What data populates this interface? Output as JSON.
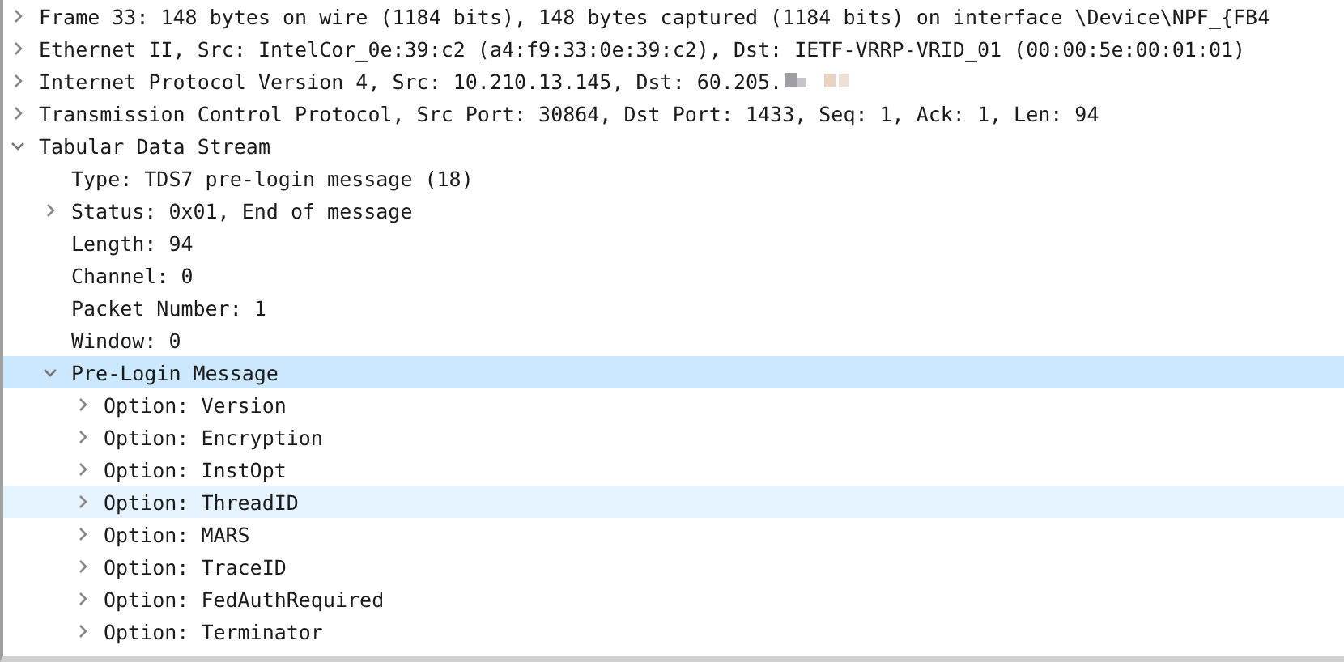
{
  "tree": [
    {
      "label": "Frame 33: 148 bytes on wire (1184 bits), 148 bytes captured (1184 bits) on interface \\Device\\NPF_{FB4",
      "expanded": false,
      "selected": false,
      "hovered": false
    },
    {
      "label": "Ethernet II, Src: IntelCor_0e:39:c2 (a4:f9:33:0e:39:c2), Dst: IETF-VRRP-VRID_01 (00:00:5e:00:01:01)",
      "expanded": false,
      "selected": false,
      "hovered": false
    },
    {
      "label": "Internet Protocol Version 4, Src: 10.210.13.145, Dst: 60.205.",
      "redacted": true,
      "expanded": false,
      "selected": false,
      "hovered": false
    },
    {
      "label": "Transmission Control Protocol, Src Port: 30864, Dst Port: 1433, Seq: 1, Ack: 1, Len: 94",
      "expanded": false,
      "selected": false,
      "hovered": false
    },
    {
      "label": "Tabular Data Stream",
      "expanded": true,
      "selected": false,
      "hovered": false,
      "children": [
        {
          "label": "Type: TDS7 pre-login message (18)",
          "selected": false,
          "hovered": false
        },
        {
          "label": "Status: 0x01, End of message",
          "expanded": false,
          "selected": false,
          "hovered": false
        },
        {
          "label": "Length: 94",
          "selected": false,
          "hovered": false
        },
        {
          "label": "Channel: 0",
          "selected": false,
          "hovered": false
        },
        {
          "label": "Packet Number: 1",
          "selected": false,
          "hovered": false
        },
        {
          "label": "Window: 0",
          "selected": false,
          "hovered": false
        },
        {
          "label": "Pre-Login Message",
          "expanded": true,
          "selected": true,
          "hovered": false,
          "children": [
            {
              "label": "Option: Version",
              "expanded": false,
              "selected": false,
              "hovered": false
            },
            {
              "label": "Option: Encryption",
              "expanded": false,
              "selected": false,
              "hovered": false
            },
            {
              "label": "Option: InstOpt",
              "expanded": false,
              "selected": false,
              "hovered": false
            },
            {
              "label": "Option: ThreadID",
              "expanded": false,
              "selected": false,
              "hovered": true
            },
            {
              "label": "Option: MARS",
              "expanded": false,
              "selected": false,
              "hovered": false
            },
            {
              "label": "Option: TraceID",
              "expanded": false,
              "selected": false,
              "hovered": false
            },
            {
              "label": "Option: FedAuthRequired",
              "expanded": false,
              "selected": false,
              "hovered": false
            },
            {
              "label": "Option: Terminator",
              "expanded": false,
              "selected": false,
              "hovered": false
            }
          ]
        }
      ]
    }
  ]
}
